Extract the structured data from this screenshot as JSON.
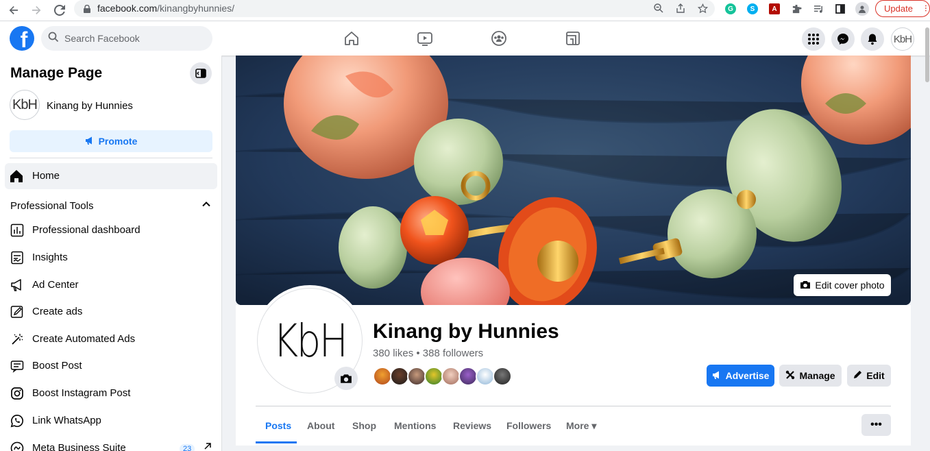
{
  "browser": {
    "url_host": "facebook.com",
    "url_path": "/kinangbyhunnies/",
    "update_label": "Update"
  },
  "fb": {
    "logo_letter": "f",
    "search_placeholder": "Search Facebook",
    "avatar_text": "KbH"
  },
  "sidebar": {
    "title": "Manage Page",
    "page_avatar_text": "KbH",
    "page_name": "Kinang by Hunnies",
    "promote_label": "Promote",
    "home_label": "Home",
    "section_label": "Professional Tools",
    "items": [
      {
        "label": "Professional dashboard",
        "icon": "dashboard-icon"
      },
      {
        "label": "Insights",
        "icon": "insights-icon"
      },
      {
        "label": "Ad Center",
        "icon": "megaphone-icon"
      },
      {
        "label": "Create ads",
        "icon": "pencil-icon"
      },
      {
        "label": "Create Automated Ads",
        "icon": "magic-wand-icon"
      },
      {
        "label": "Boost Post",
        "icon": "boost-post-icon"
      },
      {
        "label": "Boost Instagram Post",
        "icon": "instagram-icon"
      },
      {
        "label": "Link WhatsApp",
        "icon": "whatsapp-icon"
      },
      {
        "label": "Meta Business Suite",
        "icon": "meta-icon",
        "badge": "23"
      }
    ]
  },
  "page": {
    "edit_cover_label": "Edit cover photo",
    "profile_text": "KbH",
    "name": "Kinang by Hunnies",
    "stats": "380 likes • 388 followers",
    "advertise_label": "Advertise",
    "manage_label": "Manage",
    "edit_label": "Edit",
    "tabs": [
      "Posts",
      "About",
      "Shop",
      "Mentions",
      "Reviews",
      "Followers",
      "More ▾"
    ],
    "more_dots": "•••"
  },
  "colors": {
    "brand": "#1877f2",
    "update_red": "#d93025"
  }
}
